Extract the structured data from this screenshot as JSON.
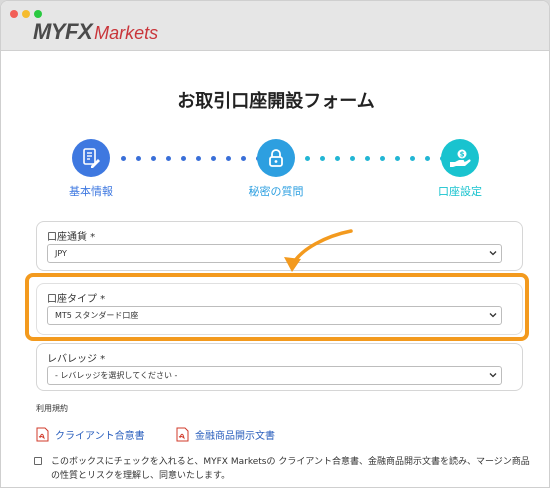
{
  "window": {
    "controls": [
      "close",
      "minimize",
      "zoom"
    ]
  },
  "logo": {
    "brand": "MYFX",
    "suffix": "Markets"
  },
  "page": {
    "title": "お取引口座開設フォーム"
  },
  "steps": [
    {
      "label": "基本情報",
      "icon": "document-edit-icon",
      "color": "#3e78e0"
    },
    {
      "label": "秘密の質問",
      "icon": "lock-icon",
      "color": "#2d9fe0"
    },
    {
      "label": "口座設定",
      "icon": "hand-coin-icon",
      "color": "#19c3cf"
    }
  ],
  "form": {
    "currency": {
      "label": "口座通貨 *",
      "value": "JPY"
    },
    "account_type": {
      "label": "口座タイプ *",
      "value": "MT5 スタンダード口座"
    },
    "leverage": {
      "label": "レバレッジ *",
      "value": "- レバレッジを選択してください -"
    }
  },
  "highlight_color": "#f39a1e",
  "terms": {
    "title": "利用規約",
    "docs": [
      {
        "label": "クライアント合意書",
        "icon": "pdf-icon"
      },
      {
        "label": "金融商品開示文書",
        "icon": "pdf-icon"
      }
    ],
    "agree_text": "このボックスにチェックを入れると、MYFX Marketsの クライアント合意書、金融商品開示文書を読み、マージン商品の性質とリスクを理解し、同意いたします。",
    "checked": false
  }
}
